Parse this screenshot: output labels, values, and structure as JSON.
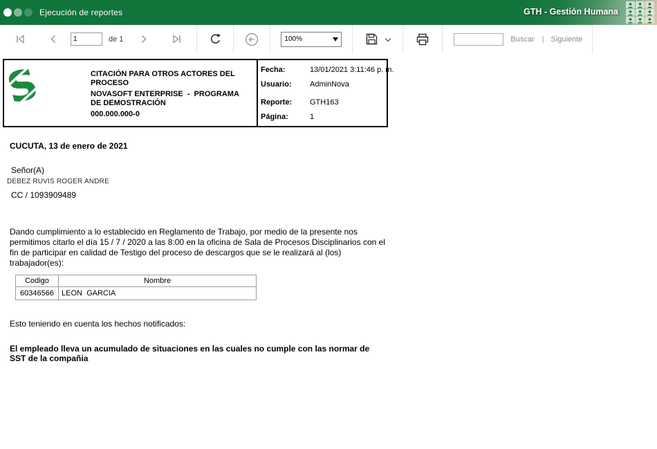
{
  "titlebar": {
    "title": "Ejecución de reportes",
    "module_label": "GTH - Gestión Humana"
  },
  "toolbar": {
    "page_value": "1",
    "page_of": "de 1",
    "zoom_value": "100%",
    "search_value": "",
    "find_label": "Buscar",
    "find_separator": "|",
    "find_next_label": "Siguiente"
  },
  "report": {
    "header": {
      "title": "CITACIÓN PARA OTROS ACTORES DEL PROCESO",
      "company": "NOVASOFT ENTERPRISE  -  PROGRAMA DE DEMOSTRACIÓN",
      "nit": "000.000.000-0",
      "meta": [
        {
          "label": "Fecha:",
          "value": "13/01/2021 3:11:46 p. m."
        },
        {
          "label": "Usuario:",
          "value": "AdminNova"
        },
        {
          "label": "Reporte:",
          "value": "GTH163"
        },
        {
          "label": "Página:",
          "value": "1"
        }
      ]
    },
    "city_date": "CUCUTA, 13 de enero de 2021",
    "salutation": "Señor(A)",
    "recipient_name": "DEBEZ RUVIS ROGER ANDRE",
    "recipient_id": "CC / 1093909489",
    "body_paragraph": "Dando cumplimiento a lo establecido en Reglamento de Trabajo, por medio de la presente nos permitimos citarlo el día 15 / 7 / 2020 a las 8:00 en la oficina de Sala de Procesos Disciplinarios con el fin de participar en calidad de Testigo del proceso de descargos que se le realizará al (los) trabajador(es):",
    "table": {
      "headers": [
        "Codigo",
        "Nombre"
      ],
      "rows": [
        {
          "codigo": "60346566",
          "nombre": "LEON  GARCIA"
        }
      ]
    },
    "facts_line": "Esto teniendo en cuenta los hechos notificados:",
    "note": "El empleado lleva un acumulado de situaciones en las cuales no cumple con las normar de SST de la compañia"
  },
  "colors": {
    "titlebar_green": "#11743a",
    "logo_green": "#1b8a3f",
    "toolbar_icon_gray": "#8c8c8c",
    "toolbar_icon_dark": "#2b2b2b"
  },
  "icons": {
    "window_dots": "three-circles",
    "first_page": "bar-left-triangle |◁",
    "prev_page": "chevron-left ‹",
    "next_page": "chevron-right ›",
    "last_page": "triangle-bar-right ▷|",
    "refresh": "circular-arrow ↻",
    "back": "circled-arrow-left ⊖",
    "zoom_dropdown": "caret-down ▾",
    "export": "floppy-disk",
    "export_menu": "chevron-down ▾",
    "print": "printer",
    "people_tile": "person-silhouette",
    "logo": "novasoft-s-mark"
  }
}
